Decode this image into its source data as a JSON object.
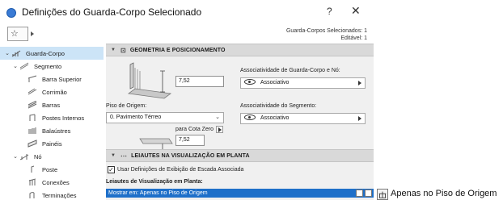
{
  "window": {
    "title": "Definições do Guarda-Corpo Selecionado",
    "help_label": "?",
    "close_label": "✕"
  },
  "favorites": {
    "label": "☆"
  },
  "selection_info": {
    "line1": "Guarda-Corpos Selecionados: 1",
    "line2": "Editável: 1"
  },
  "tree": {
    "items": [
      {
        "label": "Guarda-Corpo",
        "icon": "railing-icon",
        "chevron": "⌄"
      },
      {
        "label": "Segmento",
        "icon": "segment-icon",
        "chevron": "⌄"
      },
      {
        "label": "Barra Superior",
        "icon": "top-rail-icon"
      },
      {
        "label": "Corrimão",
        "icon": "handrail-icon"
      },
      {
        "label": "Barras",
        "icon": "rails-icon"
      },
      {
        "label": "Postes Internos",
        "icon": "inner-posts-icon"
      },
      {
        "label": "Balaústres",
        "icon": "balusters-icon"
      },
      {
        "label": "Painéis",
        "icon": "panels-icon"
      },
      {
        "label": "Nó",
        "icon": "node-icon",
        "chevron": "⌄"
      },
      {
        "label": "Poste",
        "icon": "post-icon"
      },
      {
        "label": "Conexões",
        "icon": "connections-icon"
      },
      {
        "label": "Terminações",
        "icon": "terminations-icon"
      }
    ]
  },
  "geometry": {
    "header": "GEOMETRIA E POSICIONAMENTO",
    "height_value": "7,52",
    "assoc_railing_node_label": "Associatividade de Guarda-Corpo e Nó:",
    "assoc_railing_node_value": "Associativo",
    "origin_floor_label": "Piso de Origem:",
    "origin_floor_value": "0. Pavimento Térreo",
    "assoc_segment_label": "Associatividade do Segmento:",
    "assoc_segment_value": "Associativo",
    "zero_level_label": "para Cota Zero",
    "zero_level_value": "7,52"
  },
  "layouts": {
    "header": "LEIAUTES NA VISUALIZAÇÃO EM PLANTA",
    "checkbox_label": "Usar Definições de Exibição de Escada Associada",
    "checkbox_checked": true,
    "list_label": "Leiautes de Visualização em Planta:",
    "row_text": "Mostrar em: Apenas no Piso de Origem"
  },
  "tooltip": {
    "text": "Apenas no Piso de Origem",
    "icon": "floor-plan-icon"
  },
  "colors": {
    "accent": "#1e6fc9",
    "selected_bg": "#cce4f7",
    "panel_bg": "#f0f0f0",
    "header_bg": "#d9d9d9"
  }
}
